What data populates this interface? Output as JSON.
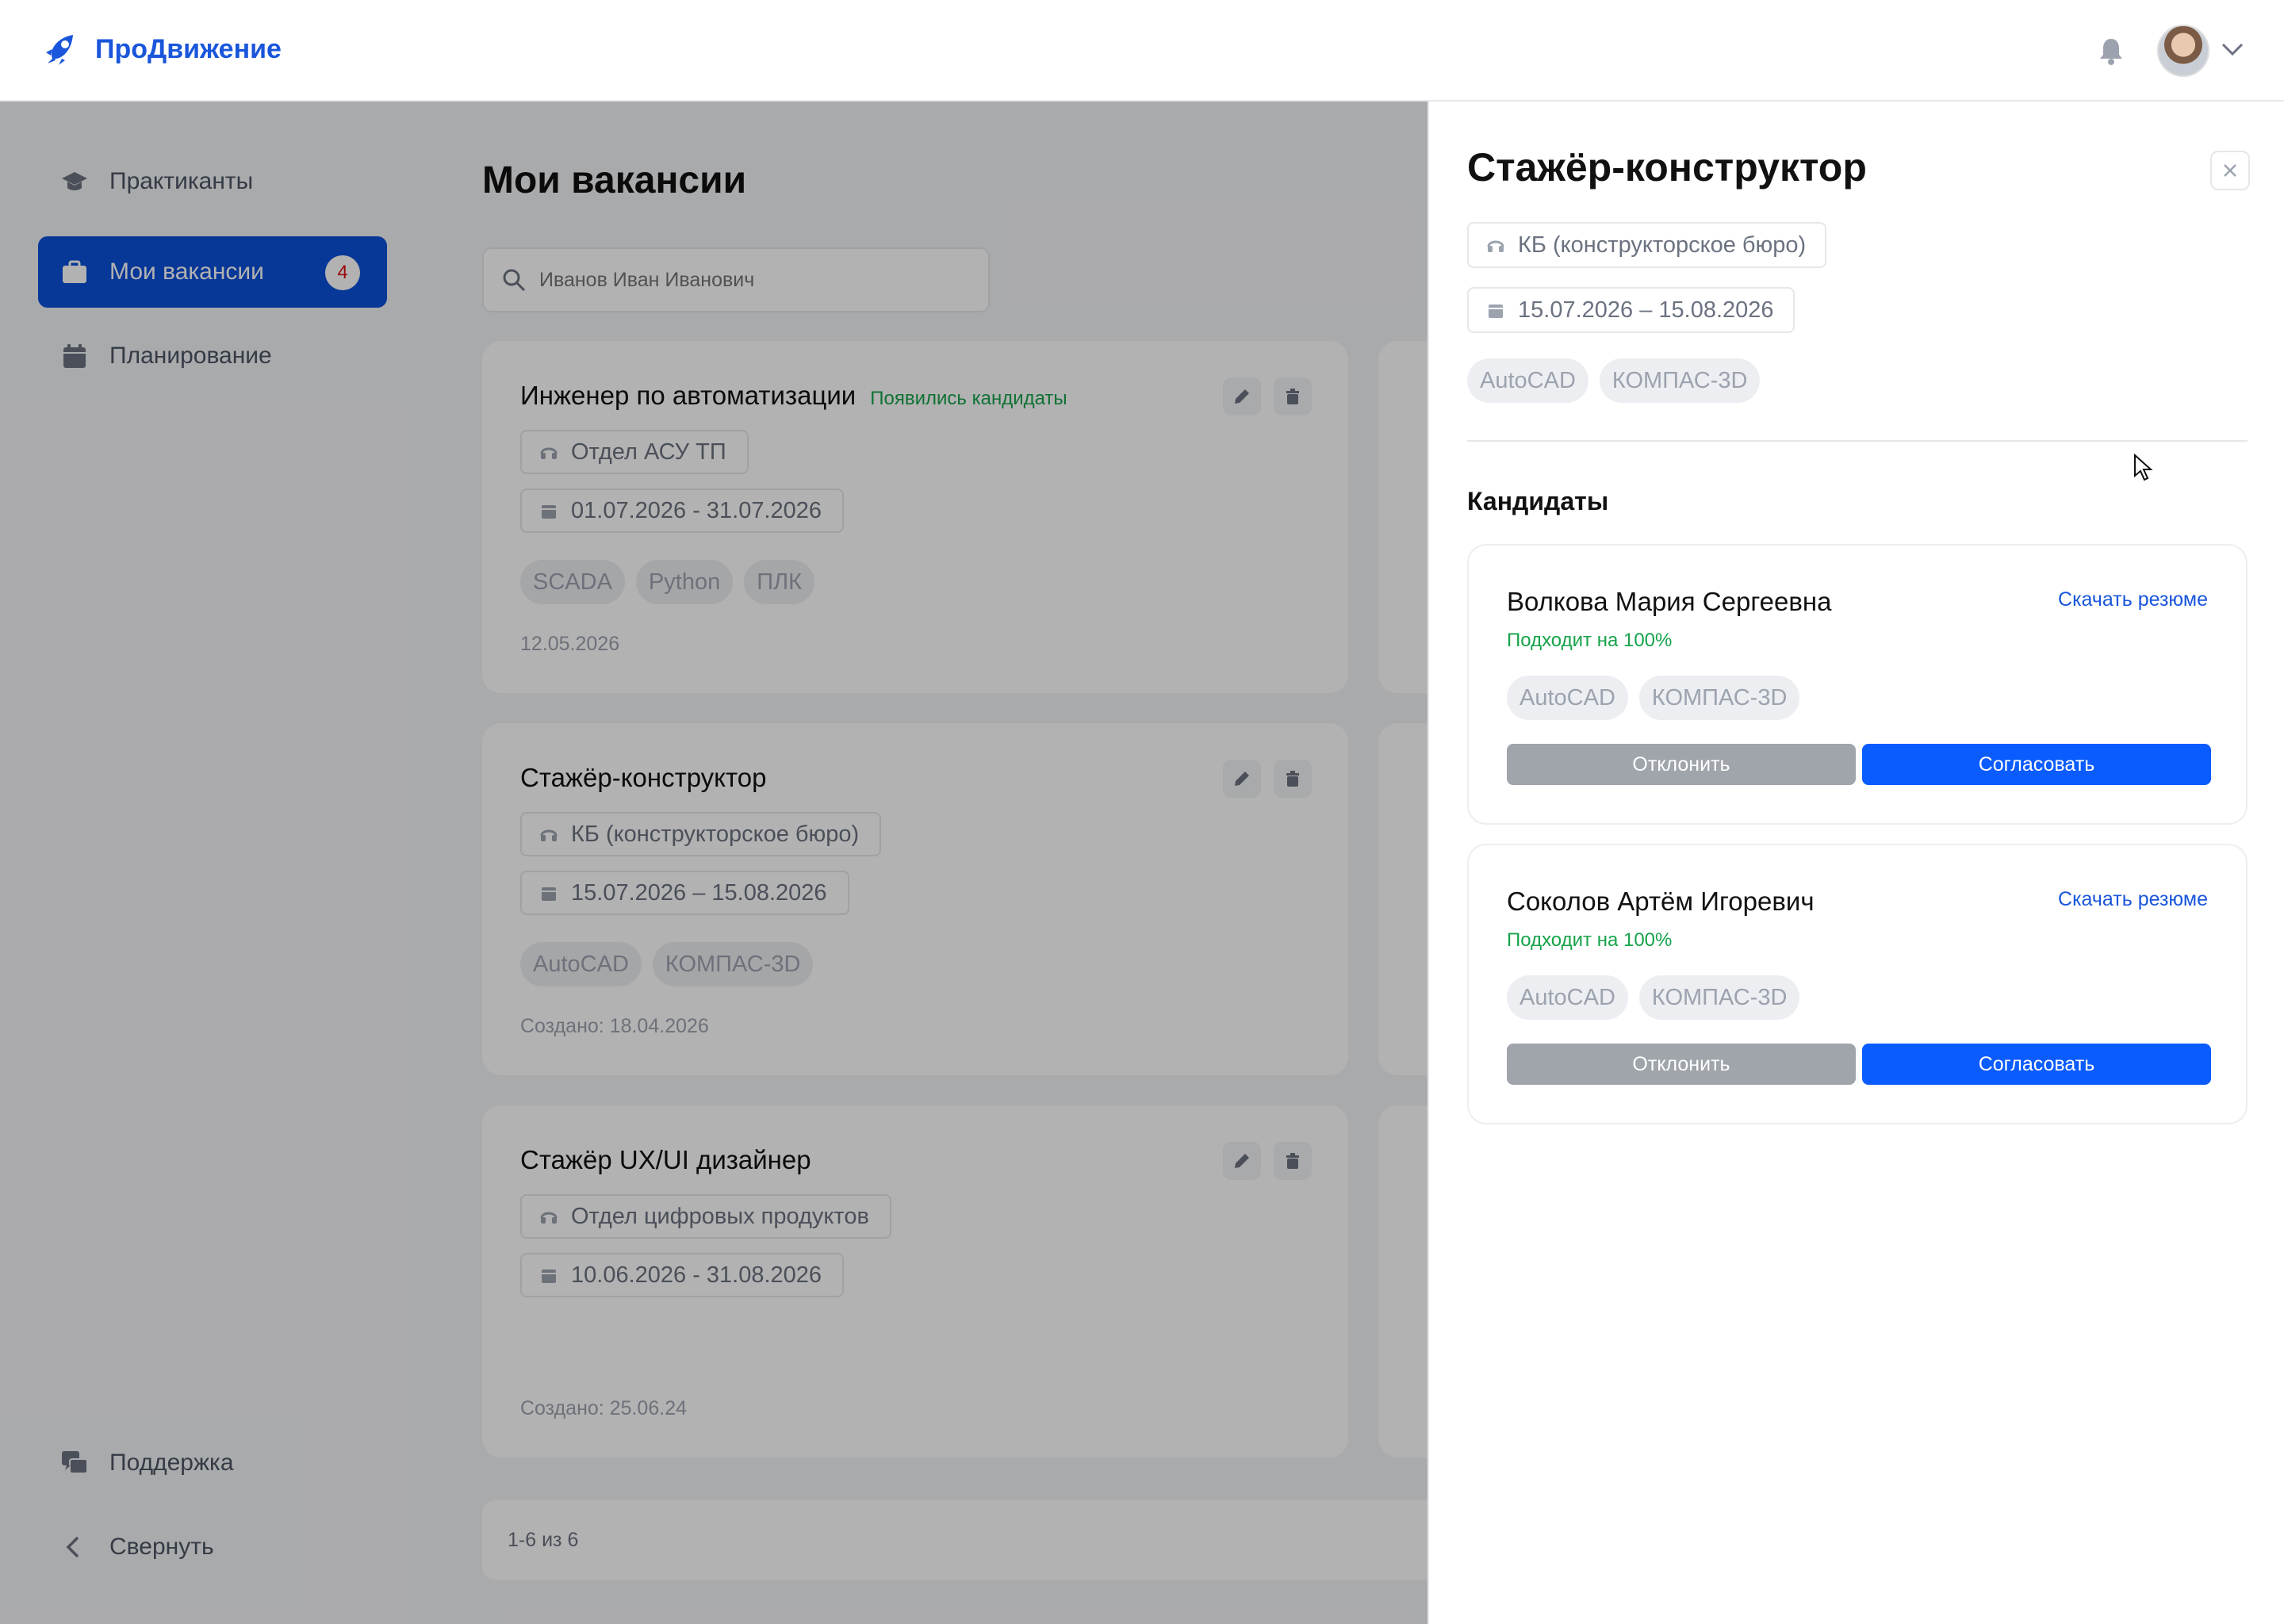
{
  "app": {
    "name": "ПроДвижение"
  },
  "header": {
    "notifications_icon": "bell-icon",
    "avatar_icon": "avatar",
    "menu_icon": "chevron-down-icon"
  },
  "sidebar": {
    "items": [
      {
        "label": "Практиканты",
        "icon": "graduation-cap-icon",
        "active": false
      },
      {
        "label": "Мои вакансии",
        "icon": "briefcase-icon",
        "active": true,
        "badge": "4"
      },
      {
        "label": "Планирование",
        "icon": "calendar-icon",
        "active": false
      }
    ],
    "bottom": [
      {
        "label": "Поддержка",
        "icon": "support-chat-icon"
      },
      {
        "label": "Свернуть",
        "icon": "chevron-left-icon"
      }
    ]
  },
  "main": {
    "title": "Мои вакансии",
    "search": {
      "placeholder": "Иванов Иван Иванович",
      "value": ""
    },
    "vacancies": [
      {
        "title": "Инженер по автоматизации",
        "status": "Появились кандидаты",
        "department": "Отдел АСУ ТП",
        "dates": "01.07.2026 - 31.07.2026",
        "tags": [
          "SCADA",
          "Python",
          "ПЛК"
        ],
        "created": "12.05.2026"
      },
      {
        "title": "Стажёр-конструктор",
        "status": "",
        "department": "КБ (конструкторское бюро)",
        "dates": "15.07.2026 – 15.08.2026",
        "tags": [
          "AutoCAD",
          "КОМПАС-3D"
        ],
        "created": "Создано: 18.04.2026"
      },
      {
        "title": "Стажёр UX/UI дизайнер",
        "status": "",
        "department": "Отдел цифровых продуктов",
        "dates": "10.06.2026 - 31.08.2026",
        "tags": [],
        "created": "Создано: 25.06.24"
      }
    ],
    "pager": "1-6 из 6"
  },
  "drawer": {
    "title": "Стажёр-конструктор",
    "department": "КБ (конструкторское бюро)",
    "dates": "15.07.2026 – 15.08.2026",
    "tags": [
      "AutoCAD",
      "КОМПАС-3D"
    ],
    "section": "Кандидаты",
    "candidates": [
      {
        "name": "Волкова Мария Сергеевна",
        "download": "Скачать резюме",
        "match": "Подходит на 100%",
        "tags": [
          "AutoCAD",
          "КОМПАС-3D"
        ],
        "reject": "Отклонить",
        "approve": "Согласовать"
      },
      {
        "name": "Соколов Артём Игоревич",
        "download": "Скачать резюме",
        "match": "Подходит на 100%",
        "tags": [
          "AutoCAD",
          "КОМПАС-3D"
        ],
        "reject": "Отклонить",
        "approve": "Согласовать"
      }
    ]
  },
  "colors": {
    "brand": "#1a56db",
    "accent": "#0b5cff",
    "success": "#16a34a",
    "badge_text": "#dd1111"
  }
}
